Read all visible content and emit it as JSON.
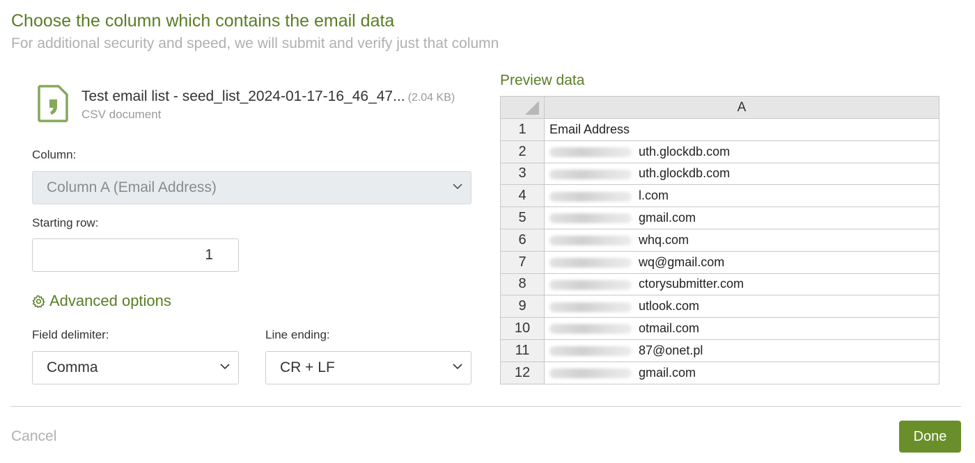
{
  "header": {
    "title": "Choose the column which contains the email data",
    "subtitle": "For additional security and speed, we will submit and verify just that column"
  },
  "file": {
    "icon": "file-quote-icon",
    "name": "Test email list - seed_list_2024-01-17-16_46_47...",
    "size": "(2.04 KB)",
    "type": "CSV document"
  },
  "form": {
    "column_label": "Column:",
    "column_value": "Column A (Email Address)",
    "starting_row_label": "Starting row:",
    "starting_row_value": "1",
    "advanced_label": "Advanced options",
    "advanced_icon": "gear-icon",
    "delimiter_label": "Field delimiter:",
    "delimiter_value": "Comma",
    "line_ending_label": "Line ending:",
    "line_ending_value": "CR + LF"
  },
  "preview": {
    "title": "Preview data",
    "column_header": "A",
    "rows": [
      {
        "num": "1",
        "value": "Email Address",
        "blurred": false
      },
      {
        "num": "2",
        "value": "uth.glockdb.com",
        "blurred": true
      },
      {
        "num": "3",
        "value": "uth.glockdb.com",
        "blurred": true
      },
      {
        "num": "4",
        "value": "l.com",
        "blurred": true
      },
      {
        "num": "5",
        "value": "gmail.com",
        "blurred": true
      },
      {
        "num": "6",
        "value": "whq.com",
        "blurred": true
      },
      {
        "num": "7",
        "value": "wq@gmail.com",
        "blurred": true
      },
      {
        "num": "8",
        "value": "ctorysubmitter.com",
        "blurred": true
      },
      {
        "num": "9",
        "value": "utlook.com",
        "blurred": true
      },
      {
        "num": "10",
        "value": "otmail.com",
        "blurred": true
      },
      {
        "num": "11",
        "value": "87@onet.pl",
        "blurred": true
      },
      {
        "num": "12",
        "value": "gmail.com",
        "blurred": true
      }
    ]
  },
  "footer": {
    "cancel_label": "Cancel",
    "done_label": "Done"
  },
  "colors": {
    "accent": "#5a7d24",
    "button": "#6a8f2a"
  }
}
